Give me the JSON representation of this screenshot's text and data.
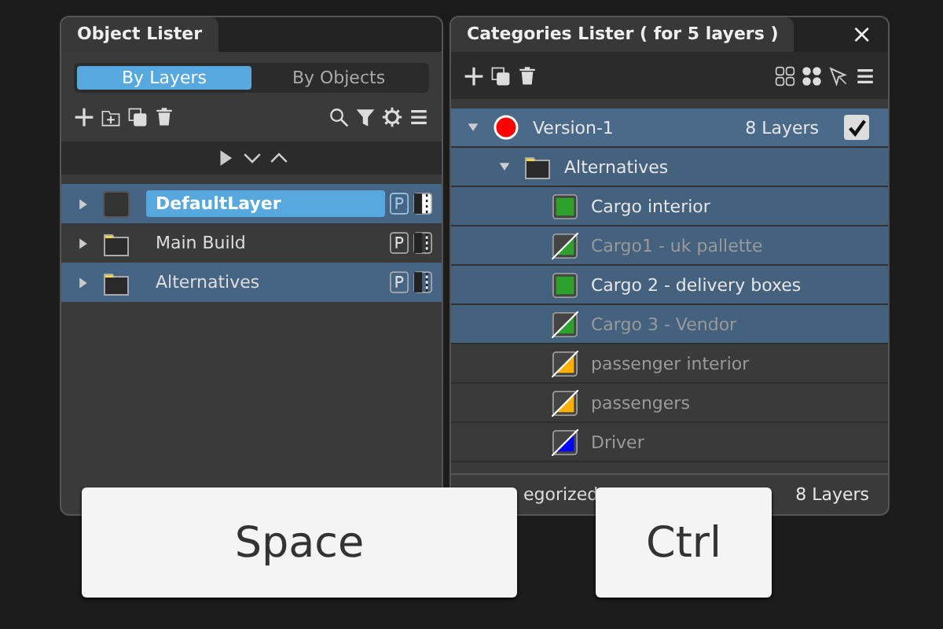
{
  "object_lister": {
    "title": "Object Lister",
    "modes": [
      {
        "label": "By Layers",
        "selected": true
      },
      {
        "label": "By Objects",
        "selected": false
      }
    ],
    "layers": [
      {
        "name": "DefaultLayer",
        "kind": "layer",
        "selected": true,
        "active": true
      },
      {
        "name": "Main Build",
        "kind": "folder",
        "selected": false,
        "active": false
      },
      {
        "name": "Alternatives",
        "kind": "folder",
        "selected": true,
        "active": false
      }
    ]
  },
  "categories_lister": {
    "title": "Categories Lister ( for 5 layers )",
    "close": "×",
    "version": {
      "name": "Version-1",
      "color": "#ff0000",
      "count": "8 Layers",
      "checked": true,
      "expanded": true
    },
    "group": {
      "name": "Alternatives",
      "expanded": true
    },
    "categories": [
      {
        "name": "Cargo interior",
        "color": "#2ea02e",
        "visible": true,
        "selected": true
      },
      {
        "name": "Cargo1 - uk pallette",
        "color": "#2ea02e",
        "visible": false,
        "selected": true
      },
      {
        "name": "Cargo 2 - delivery boxes",
        "color": "#2ea02e",
        "visible": true,
        "selected": true
      },
      {
        "name": "Cargo 3 - Vendor",
        "color": "#2ea02e",
        "visible": false,
        "selected": true
      },
      {
        "name": "passenger interior",
        "color": "#ffb000",
        "visible": false,
        "selected": false
      },
      {
        "name": "passengers",
        "color": "#ffb000",
        "visible": false,
        "selected": false
      },
      {
        "name": "Driver",
        "color": "#0000ff",
        "visible": false,
        "selected": false
      }
    ],
    "footer": {
      "label": "egorized",
      "count": "8 Layers"
    }
  },
  "keys": [
    "Space",
    "Ctrl"
  ]
}
